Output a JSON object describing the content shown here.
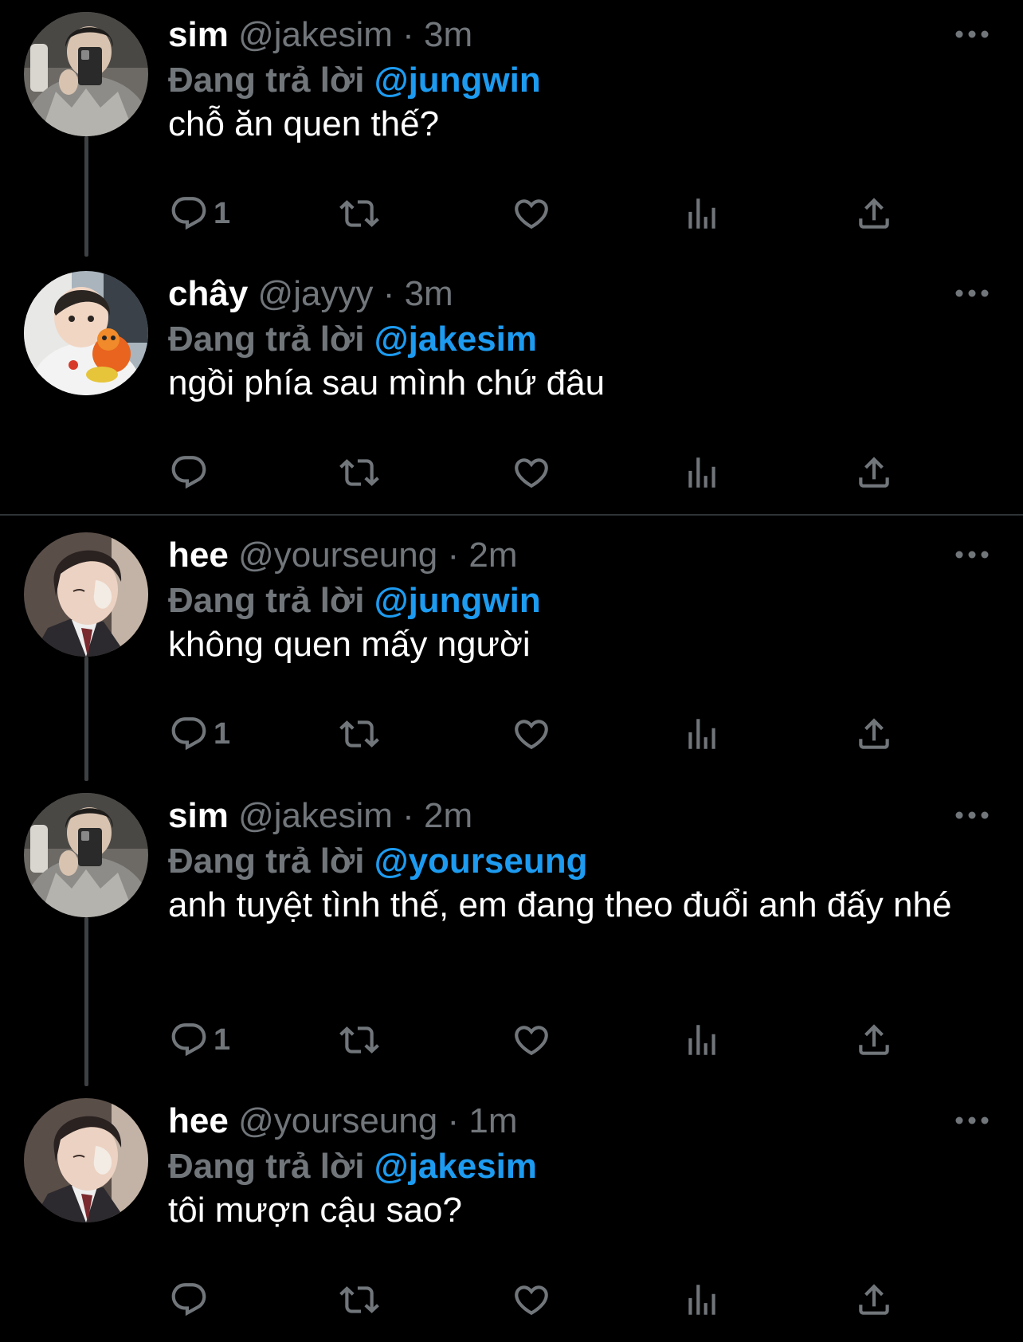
{
  "colors": {
    "background": "#000000",
    "muted": "#71767b",
    "mention": "#1d9bf0",
    "text": "#ffffff"
  },
  "tweets": [
    {
      "display_name": "sim",
      "handle": "@jakesim",
      "separator": "·",
      "time": "3m",
      "reply_prefix": "Đang trả lời",
      "reply_to": "@jungwin",
      "text": "chỗ ăn quen thế?",
      "reply_count": "1",
      "avatar": "avatar-sim"
    },
    {
      "display_name": "chây",
      "handle": "@jayyy",
      "separator": "·",
      "time": "3m",
      "reply_prefix": "Đang trả lời",
      "reply_to": "@jakesim",
      "text": "ngồi phía sau mình chứ đâu",
      "reply_count": "",
      "avatar": "avatar-chay"
    },
    {
      "display_name": "hee",
      "handle": "@yourseung",
      "separator": "·",
      "time": "2m",
      "reply_prefix": "Đang trả lời",
      "reply_to": "@jungwin",
      "text": "không quen mấy người",
      "reply_count": "1",
      "avatar": "avatar-hee"
    },
    {
      "display_name": "sim",
      "handle": "@jakesim",
      "separator": "·",
      "time": "2m",
      "reply_prefix": "Đang trả lời",
      "reply_to": "@yourseung",
      "text": "anh tuyệt tình thế, em đang theo đuổi anh đấy nhé",
      "reply_count": "1",
      "avatar": "avatar-sim"
    },
    {
      "display_name": "hee",
      "handle": "@yourseung",
      "separator": "·",
      "time": "1m",
      "reply_prefix": "Đang trả lời",
      "reply_to": "@jakesim",
      "text": "tôi mượn cậu sao?",
      "reply_count": "",
      "avatar": "avatar-hee"
    }
  ],
  "icons": {
    "reply": "reply-icon",
    "retweet": "retweet-icon",
    "like": "heart-icon",
    "analytics": "analytics-icon",
    "share": "share-icon",
    "more": "more-icon"
  }
}
